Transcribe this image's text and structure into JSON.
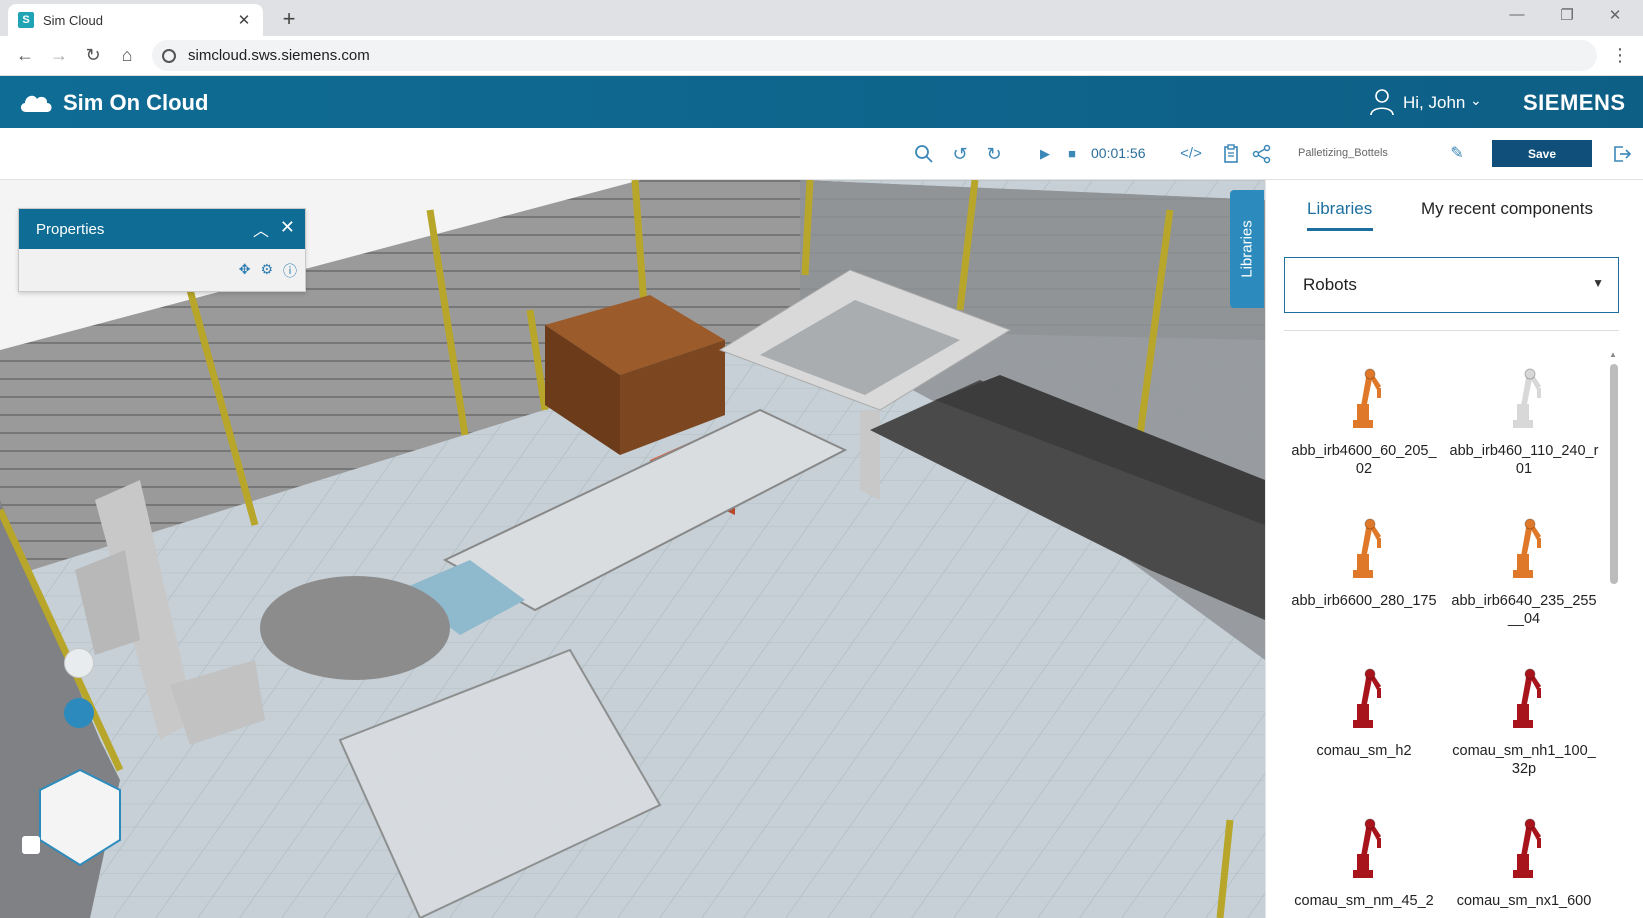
{
  "browser": {
    "tab_title": "Sim Cloud",
    "tab_favicon": "S",
    "url": "simcloud.sws.siemens.com"
  },
  "header": {
    "app_title": "Sim On Cloud",
    "greeting": "Hi, John",
    "brand": "SIEMENS"
  },
  "toolbar": {
    "timer": "00:01:56",
    "project_name": "Palletizing_Bottels",
    "save_label": "Save"
  },
  "properties": {
    "title": "Properties"
  },
  "side_tab": {
    "label": "Libraries"
  },
  "library_panel": {
    "tabs": [
      {
        "label": "Libraries",
        "active": true
      },
      {
        "label": "My recent components",
        "active": false
      }
    ],
    "category": "Robots",
    "items": [
      {
        "label": "abb_irb4600_60_205_02",
        "color": "#e0782a"
      },
      {
        "label": "abb_irb460_110_240_r01",
        "color": "#d8d8d8"
      },
      {
        "label": "abb_irb6600_280_175",
        "color": "#e0782a"
      },
      {
        "label": "abb_irb6640_235_255__04",
        "color": "#e0782a"
      },
      {
        "label": "comau_sm_h2",
        "color": "#a8141c"
      },
      {
        "label": "comau_sm_nh1_100_32p",
        "color": "#a8141c"
      },
      {
        "label": "comau_sm_nm_45_2",
        "color": "#a8141c"
      },
      {
        "label": "comau_sm_nx1_600",
        "color": "#a8141c"
      }
    ]
  }
}
